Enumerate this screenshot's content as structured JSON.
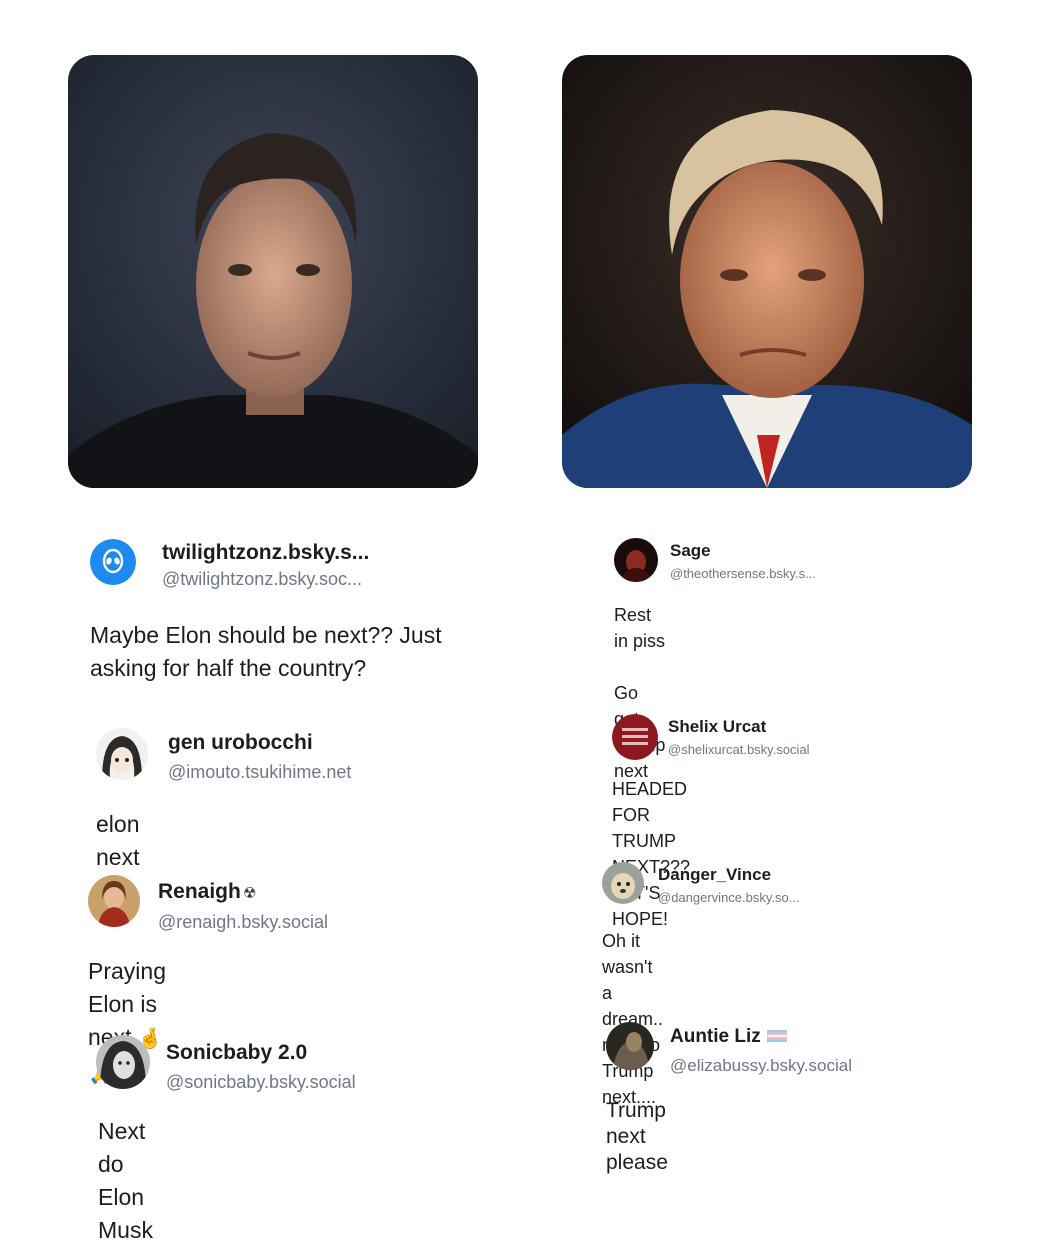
{
  "photos": {
    "left": {
      "icon": "portrait-photo-left"
    },
    "right": {
      "icon": "portrait-photo-right"
    }
  },
  "left_posts": [
    {
      "name": "twilightzonz.bsky.s...",
      "handle": "@twilightzonz.bsky.soc...",
      "text": "Maybe Elon should be next?? Just\nasking for half the country?",
      "avatar": "alien-avatar-icon"
    },
    {
      "name": "gen urobocchi",
      "handle": "@imouto.tsukihime.net",
      "text": "elon next pls",
      "avatar": "anime-avatar"
    },
    {
      "name": "Renaigh",
      "name_suffix": "☢",
      "handle": "@renaigh.bsky.social",
      "text": "Praying Elon is next",
      "text_emoji": "🤞🙏",
      "avatar": "painting-avatar"
    },
    {
      "name": "Sonicbaby 2.0",
      "handle": "@sonicbaby.bsky.social",
      "text": "Next do Elon Musk",
      "avatar": "bw-photo-avatar"
    }
  ],
  "right_posts": [
    {
      "name": "Sage",
      "handle": "@theothersense.bsky.s...",
      "text": "Rest in piss\n\nGo get Trump next",
      "avatar": "dark-red-avatar"
    },
    {
      "name": "Shelix Urcat",
      "handle": "@shelixurcat.bsky.social",
      "text": "HEADED FOR TRUMP NEXT???\nLET'S HOPE!",
      "avatar": "red-badge-avatar"
    },
    {
      "name": "Danger_Vince",
      "handle": "@dangervince.bsky.so...",
      "text": "Oh it wasn't a dream.. now do Trump\nnext....",
      "avatar": "dog-avatar"
    },
    {
      "name": "Auntie Liz",
      "handle": "@elizabussy.bsky.social",
      "text": "Trump next please",
      "avatar": "dark-photo-avatar",
      "flag": "flag-icon"
    }
  ],
  "colors": {
    "bluesky_blue": "#1d8af0",
    "handle_gray": "#6f7785",
    "text": "#1b1d22"
  }
}
